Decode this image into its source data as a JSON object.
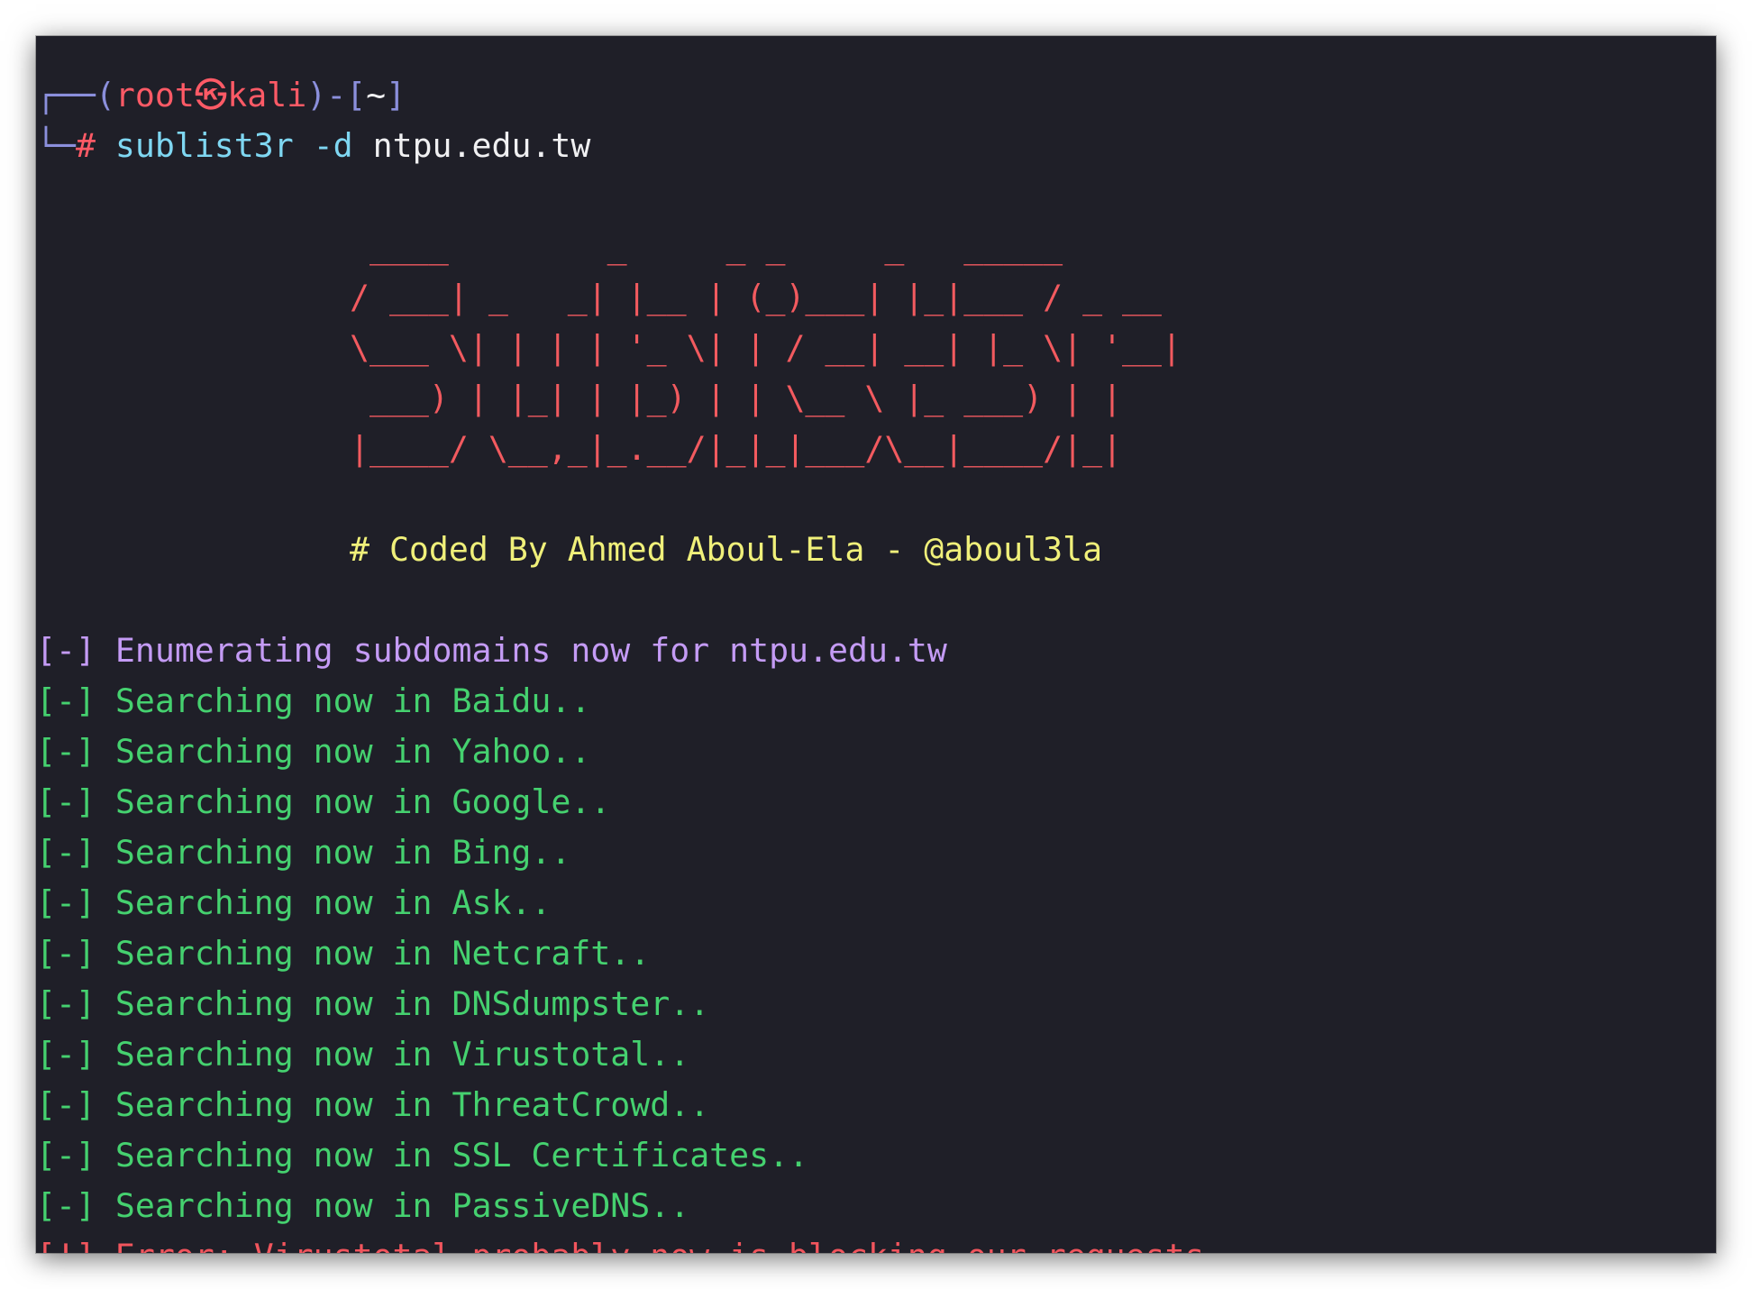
{
  "prompt": {
    "frame_open": "┌──(",
    "user_host": "root㉿kali",
    "frame_mid": ")-[",
    "cwd": "~",
    "frame_close": "]",
    "frame_bottom": "└─",
    "symbol": "#",
    "command": "sublist3r",
    "flag": "-d",
    "argument": "ntpu.edu.tw"
  },
  "banner": {
    "lines": [
      " ____        _     _ _     _   _____",
      "/ ___| _   _| |__ | (_)___| |_|___ / _ __",
      "\\___ \\| | | | '_ \\| | / __| __| |_ \\| '__|",
      " ___) | |_| | |_) | | \\__ \\ |_ ___) | |",
      "|____/ \\__,_|_.__/|_|_|___/\\__|____/|_|"
    ],
    "credit": "# Coded By Ahmed Aboul-Ela - @aboul3la"
  },
  "output": {
    "enumerating": "[-] Enumerating subdomains now for ntpu.edu.tw",
    "searches": [
      {
        "prefix": "[-]",
        "text": "Searching now in Baidu.."
      },
      {
        "prefix": "[-]",
        "text": "Searching now in Yahoo.."
      },
      {
        "prefix": "[-]",
        "text": "Searching now in Google.."
      },
      {
        "prefix": "[-]",
        "text": "Searching now in Bing.."
      },
      {
        "prefix": "[-]",
        "text": "Searching now in Ask.."
      },
      {
        "prefix": "[-]",
        "text": "Searching now in Netcraft.."
      },
      {
        "prefix": "[-]",
        "text": "Searching now in DNSdumpster.."
      },
      {
        "prefix": "[-]",
        "text": "Searching now in Virustotal.."
      },
      {
        "prefix": "[-]",
        "text": "Searching now in ThreatCrowd.."
      },
      {
        "prefix": "[-]",
        "text": "Searching now in SSL Certificates.."
      },
      {
        "prefix": "[-]",
        "text": "Searching now in PassiveDNS.."
      }
    ],
    "error": "[!] Error: Virustotal probably now is blocking our requests"
  },
  "colors": {
    "background": "#1f1f28",
    "prompt_frame": "#8b8fdc",
    "prompt_user": "#ff5a66",
    "command": "#7fd7f2",
    "banner": "#f25a5f",
    "credit": "#f0f07a",
    "enumerating": "#c49bf5",
    "search": "#45d16f",
    "error": "#f2555d"
  }
}
